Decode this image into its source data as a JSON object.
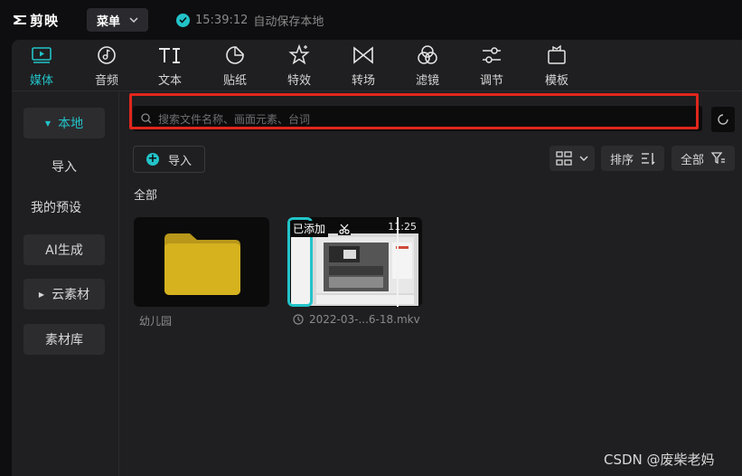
{
  "app": {
    "logo_text": "剪映"
  },
  "titlebar": {
    "menu_label": "菜单",
    "save_time": "15:39:12",
    "save_text": "自动保存本地"
  },
  "tools": [
    {
      "label": "媒体",
      "icon": "media-icon",
      "active": true
    },
    {
      "label": "音频",
      "icon": "audio-icon"
    },
    {
      "label": "文本",
      "icon": "text-icon"
    },
    {
      "label": "贴纸",
      "icon": "sticker-icon"
    },
    {
      "label": "特效",
      "icon": "effects-icon"
    },
    {
      "label": "转场",
      "icon": "transition-icon"
    },
    {
      "label": "滤镜",
      "icon": "filter-icon"
    },
    {
      "label": "调节",
      "icon": "adjust-icon"
    },
    {
      "label": "模板",
      "icon": "template-icon"
    }
  ],
  "sidebar": {
    "items": [
      {
        "label": "本地",
        "active": true
      },
      {
        "label": "导入"
      },
      {
        "label": "我的预设"
      },
      {
        "label": "AI生成"
      },
      {
        "label": "云素材"
      },
      {
        "label": "素材库"
      }
    ]
  },
  "search": {
    "placeholder": "搜索文件名称、画面元素、台词"
  },
  "actions": {
    "import_label": "导入",
    "sort_label": "排序",
    "filter_label": "全部"
  },
  "section_label": "全部",
  "media": [
    {
      "name": "幼儿园",
      "type": "folder"
    },
    {
      "name": "2022-03-...6-18.mkv",
      "type": "video",
      "badge": "已添加",
      "duration": "11:25"
    }
  ],
  "watermark": "CSDN @废柴老妈",
  "colors": {
    "accent": "#22c3c8",
    "highlight": "#e1261c",
    "folder": "#d6b21f"
  }
}
